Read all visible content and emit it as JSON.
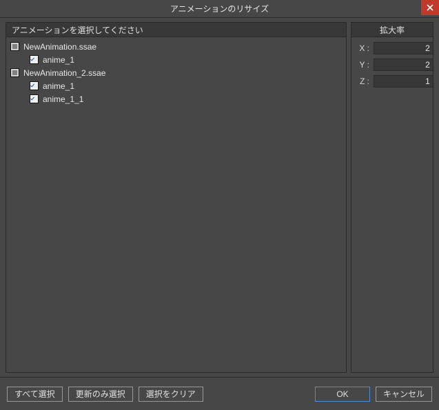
{
  "window": {
    "title": "アニメーションのリサイズ"
  },
  "panels": {
    "list_header": "アニメーションを選択してください",
    "scale_header": "拡大率"
  },
  "tree": [
    {
      "level": 0,
      "state": "tri",
      "label": "NewAnimation.ssae"
    },
    {
      "level": 1,
      "state": "checked",
      "label": "anime_1"
    },
    {
      "level": 0,
      "state": "tri",
      "label": "NewAnimation_2.ssae"
    },
    {
      "level": 1,
      "state": "checked",
      "label": "anime_1"
    },
    {
      "level": 1,
      "state": "checked",
      "label": "anime_1_1"
    }
  ],
  "scale": {
    "x_label": "X :",
    "x_value": "2",
    "y_label": "Y :",
    "y_value": "2",
    "z_label": "Z :",
    "z_value": "1"
  },
  "buttons": {
    "select_all": "すべて選択",
    "select_updated": "更新のみ選択",
    "clear_selection": "選択をクリア",
    "ok": "OK",
    "cancel": "キャンセル"
  }
}
